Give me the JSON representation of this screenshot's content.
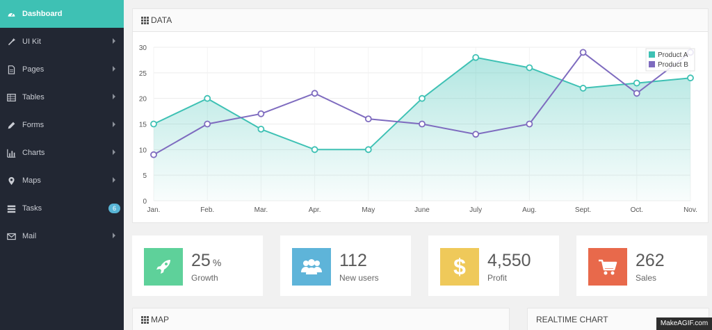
{
  "sidebar": {
    "items": [
      {
        "label": "Dashboard",
        "icon": "dashboard-icon",
        "active": true
      },
      {
        "label": "UI Kit",
        "icon": "magic-wand-icon"
      },
      {
        "label": "Pages",
        "icon": "document-icon"
      },
      {
        "label": "Tables",
        "icon": "table-icon"
      },
      {
        "label": "Forms",
        "icon": "pencil-icon"
      },
      {
        "label": "Charts",
        "icon": "bar-chart-icon"
      },
      {
        "label": "Maps",
        "icon": "map-marker-icon"
      },
      {
        "label": "Tasks",
        "icon": "tasks-icon",
        "badge": "6"
      },
      {
        "label": "Mail",
        "icon": "envelope-icon"
      }
    ]
  },
  "data_panel": {
    "title": "DATA"
  },
  "chart_data": {
    "type": "line",
    "categories": [
      "Jan.",
      "Feb.",
      "Mar.",
      "Apr.",
      "May",
      "June",
      "July",
      "Aug.",
      "Sept.",
      "Oct.",
      "Nov."
    ],
    "series": [
      {
        "name": "Product A",
        "values": [
          15,
          20,
          14,
          10,
          10,
          20,
          28,
          26,
          22,
          23,
          24
        ],
        "color": "#3ec1b4",
        "fill": true
      },
      {
        "name": "Product B",
        "values": [
          9,
          15,
          17,
          21,
          16,
          15,
          13,
          15,
          29,
          21,
          29
        ],
        "color": "#7e6bbf",
        "fill": false
      }
    ],
    "ylim": [
      0,
      30
    ],
    "yticks": [
      "0",
      "5",
      "10",
      "15",
      "20",
      "25",
      "30"
    ],
    "grid": true,
    "legend": "top-right"
  },
  "stats": [
    {
      "value": "25",
      "unit": "%",
      "label": "Growth",
      "icon": "rocket-icon",
      "color": "#5ed19a"
    },
    {
      "value": "112",
      "unit": "",
      "label": "New users",
      "icon": "users-icon",
      "color": "#5eb4d9"
    },
    {
      "value": "4,550",
      "unit": "",
      "label": "Profit",
      "icon": "dollar-icon",
      "color": "#efc95a"
    },
    {
      "value": "262",
      "unit": "",
      "label": "Sales",
      "icon": "cart-icon",
      "color": "#e8694b"
    }
  ],
  "map_panel": {
    "title": "MAP"
  },
  "realtime_panel": {
    "title": "REALTIME CHART"
  },
  "watermark": "MakeAGIF.com"
}
